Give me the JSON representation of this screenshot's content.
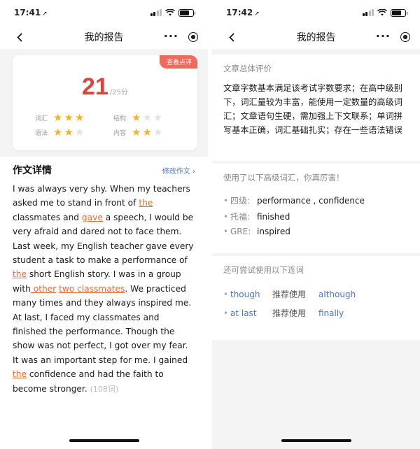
{
  "left": {
    "status": {
      "time": "17:41"
    },
    "nav": {
      "title": "我的报告"
    },
    "score_card": {
      "badge": "查看点评",
      "score": "21",
      "max": "/25分",
      "ratings": [
        {
          "label": "词汇",
          "stars": 3
        },
        {
          "label": "结构",
          "stars": 1
        },
        {
          "label": "语法",
          "stars": 2
        },
        {
          "label": "内容",
          "stars": 2
        }
      ]
    },
    "detail": {
      "title": "作文详情",
      "edit": "修改作文 ›",
      "essay": {
        "s1": "I was always very shy. When my teachers asked me to stand in front of ",
        "h1": "the",
        "s2": " classmates and ",
        "h2": "gave",
        "s3": " a speech, I would be very afraid and dared not to face them. Last week, my English teacher gave every student a task to make a performance of ",
        "h3": "the",
        "s4": " short English story. I was in a group with",
        "h4": " other",
        "s5": " ",
        "h5": "two classmates",
        "s6": ". We practiced many times and they always inspired me. At last, I faced my classmates and finished the performance. Though the show was not perfect, I got over my fear. It was an important step for me. I gained",
        "h6": " the",
        "s7": " confidence and had the faith to become stronger. ",
        "count": "(108词)"
      }
    }
  },
  "right": {
    "status": {
      "time": "17:42"
    },
    "nav": {
      "title": "我的报告"
    },
    "overall": {
      "heading": "文章总体评价",
      "text": "文章字数基本满足该考试字数要求；在高中级别下，词汇量较为丰富，能使用一定数量的高级词汇；文章语句生硬，需加强上下文联系；单词拼写基本正确，词汇基础扎实；存在一些语法错误"
    },
    "vocab": {
      "heading": "使用了以下高级词汇，你真厉害！",
      "items": [
        {
          "label": "四级:",
          "words": "performance , confidence"
        },
        {
          "label": "托福:",
          "words": "finished"
        },
        {
          "label": "GRE:",
          "words": "inspired"
        }
      ]
    },
    "connectors": {
      "heading": "还可尝试使用以下连词",
      "items": [
        {
          "from": "though",
          "mid": "推荐使用",
          "to": "although"
        },
        {
          "from": "at last",
          "mid": "推荐使用",
          "to": "finally"
        }
      ]
    }
  },
  "colors": {
    "accent_red": "#d8463a",
    "star": "#f5b324",
    "link_blue": "#4a73d8",
    "highlight": "#e86a33"
  }
}
